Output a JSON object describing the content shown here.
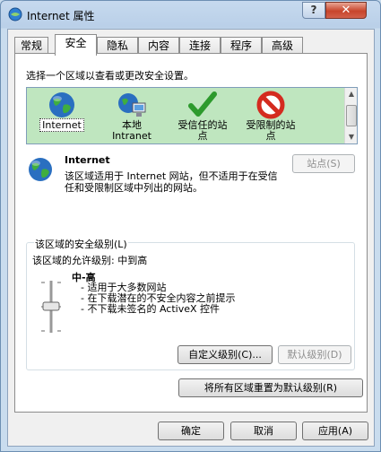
{
  "window": {
    "title": "Internet 属性",
    "help_label": "?",
    "close_label": "✕"
  },
  "tabs": [
    {
      "label": "常规"
    },
    {
      "label": "安全"
    },
    {
      "label": "隐私"
    },
    {
      "label": "内容"
    },
    {
      "label": "连接"
    },
    {
      "label": "程序"
    },
    {
      "label": "高级"
    }
  ],
  "security": {
    "zone_prompt": "选择一个区域以查看或更改安全设置。",
    "zones": [
      {
        "name": "Internet",
        "icon": "globe-icon"
      },
      {
        "name": "本地\nIntranet",
        "icon": "local-intranet-icon"
      },
      {
        "name": "受信任的站\n点",
        "icon": "checkmark-icon"
      },
      {
        "name": "受限制的站\n点",
        "icon": "forbidden-icon"
      }
    ],
    "selected_zone": {
      "name": "Internet",
      "description": "该区域适用于 Internet 网站，但不适用于在受信任和受限制区域中列出的网站。"
    },
    "sites_button": "站点(S)",
    "level_group_title": "该区域的安全级别(L)",
    "allowed_levels": "该区域的允许级别: 中到高",
    "level_name": "中-高",
    "level_items": [
      "适用于大多数网站",
      "在下载潜在的不安全内容之前提示",
      "不下载未签名的 ActiveX 控件"
    ],
    "custom_level_button": "自定义级别(C)...",
    "default_level_button": "默认级别(D)",
    "reset_all_button": "将所有区域重置为默认级别(R)"
  },
  "footer": {
    "ok": "确定",
    "cancel": "取消",
    "apply": "应用(A)"
  },
  "colors": {
    "zone_list_bg": "#bfe6bf",
    "titlebar": "#b9cfe8",
    "close_button": "#c8452b"
  }
}
